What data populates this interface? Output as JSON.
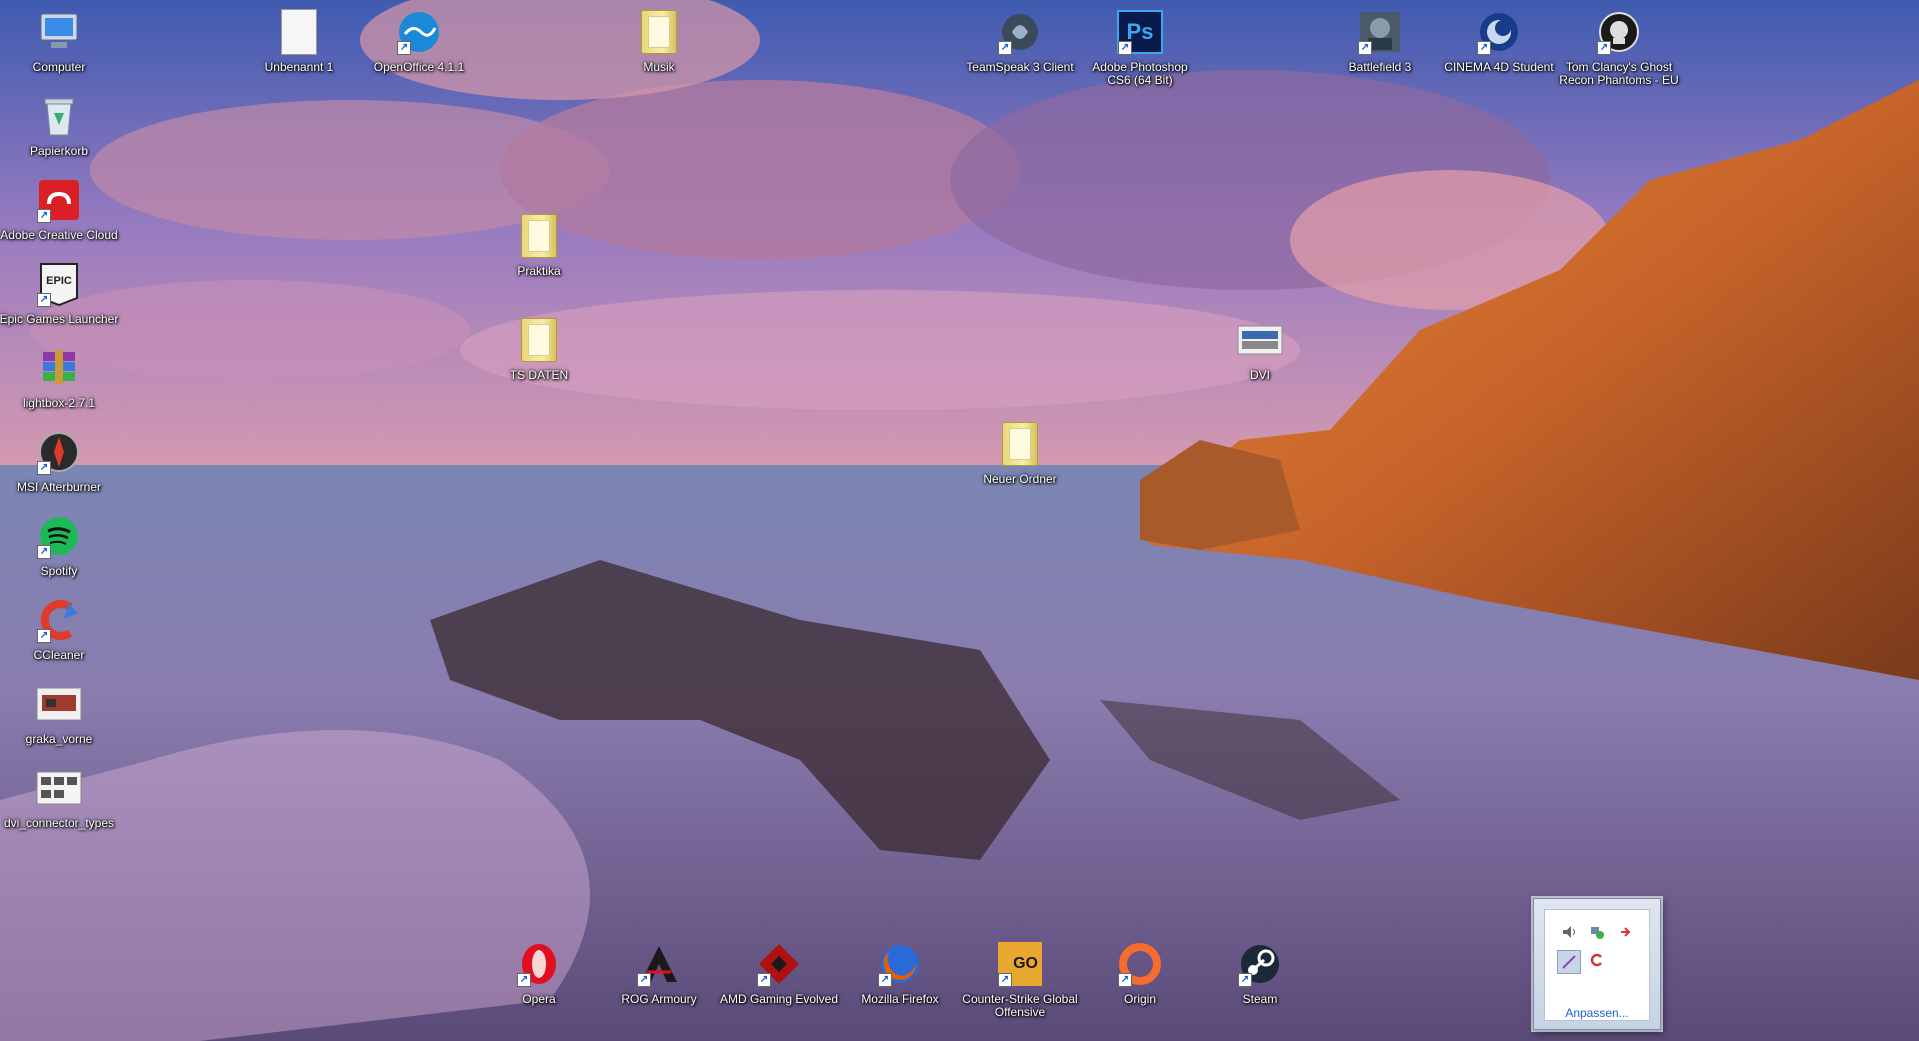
{
  "desktop": {
    "icons_left": [
      {
        "name": "computer-icon",
        "label": "Computer"
      },
      {
        "name": "recycle-bin-icon",
        "label": "Papierkorb"
      },
      {
        "name": "adobe-creative-cloud-icon",
        "label": "Adobe Creative Cloud"
      },
      {
        "name": "epic-games-icon",
        "label": "Epic Games Launcher"
      },
      {
        "name": "winrar-archive-icon",
        "label": "lightbox-2.7.1"
      },
      {
        "name": "msi-afterburner-icon",
        "label": "MSI Afterburner"
      },
      {
        "name": "spotify-icon",
        "label": "Spotify"
      },
      {
        "name": "ccleaner-icon",
        "label": "CCleaner"
      },
      {
        "name": "image-file-icon",
        "label": "graka_vorne"
      },
      {
        "name": "image-file-icon",
        "label": "dvi_connector_types"
      }
    ],
    "icons_top": [
      {
        "name": "document-icon",
        "label": "Unbenannt 1"
      },
      {
        "name": "openoffice-icon",
        "label": "OpenOffice 4.1.1"
      },
      {
        "name": "folder-icon",
        "label": "Musik"
      },
      {
        "name": "teamspeak-icon",
        "label": "TeamSpeak 3 Client"
      },
      {
        "name": "photoshop-icon",
        "label": "Adobe Photoshop CS6 (64 Bit)",
        "badge": "Ps"
      },
      {
        "name": "battlefield-icon",
        "label": "Battlefield 3"
      },
      {
        "name": "cinema4d-icon",
        "label": "CINEMA 4D Student"
      },
      {
        "name": "ghost-recon-icon",
        "label": "Tom Clancy's Ghost Recon Phantoms - EU"
      }
    ],
    "icons_middle": [
      {
        "name": "folder-icon",
        "label": "Praktika"
      },
      {
        "name": "folder-icon",
        "label": "TS DATEN"
      },
      {
        "name": "image-file-icon",
        "label": "DVI"
      },
      {
        "name": "folder-icon",
        "label": "Neuer Ordner"
      }
    ],
    "icons_bottom": [
      {
        "name": "opera-icon",
        "label": "Opera"
      },
      {
        "name": "rog-armoury-icon",
        "label": "ROG Armoury"
      },
      {
        "name": "amd-gaming-evolved-icon",
        "label": "AMD Gaming Evolved"
      },
      {
        "name": "firefox-icon",
        "label": "Mozilla Firefox"
      },
      {
        "name": "csgo-icon",
        "label": "Counter-Strike Global Offensive",
        "badge": "GO"
      },
      {
        "name": "origin-icon",
        "label": "Origin"
      },
      {
        "name": "steam-icon",
        "label": "Steam"
      }
    ]
  },
  "tray_popup": {
    "icons": [
      "speaker-icon",
      "network-icon",
      "bluetooth-icon",
      "pen-icon",
      "sync-icon"
    ],
    "link_label": "Anpassen..."
  },
  "colors": {
    "photoshop": "#0a1a4a",
    "adobe_cc": "#da1f26",
    "spotify": "#1db954",
    "opera": "#e01020",
    "firefox": "#e66000",
    "origin": "#f56c2d",
    "steam": "#1b2838"
  }
}
